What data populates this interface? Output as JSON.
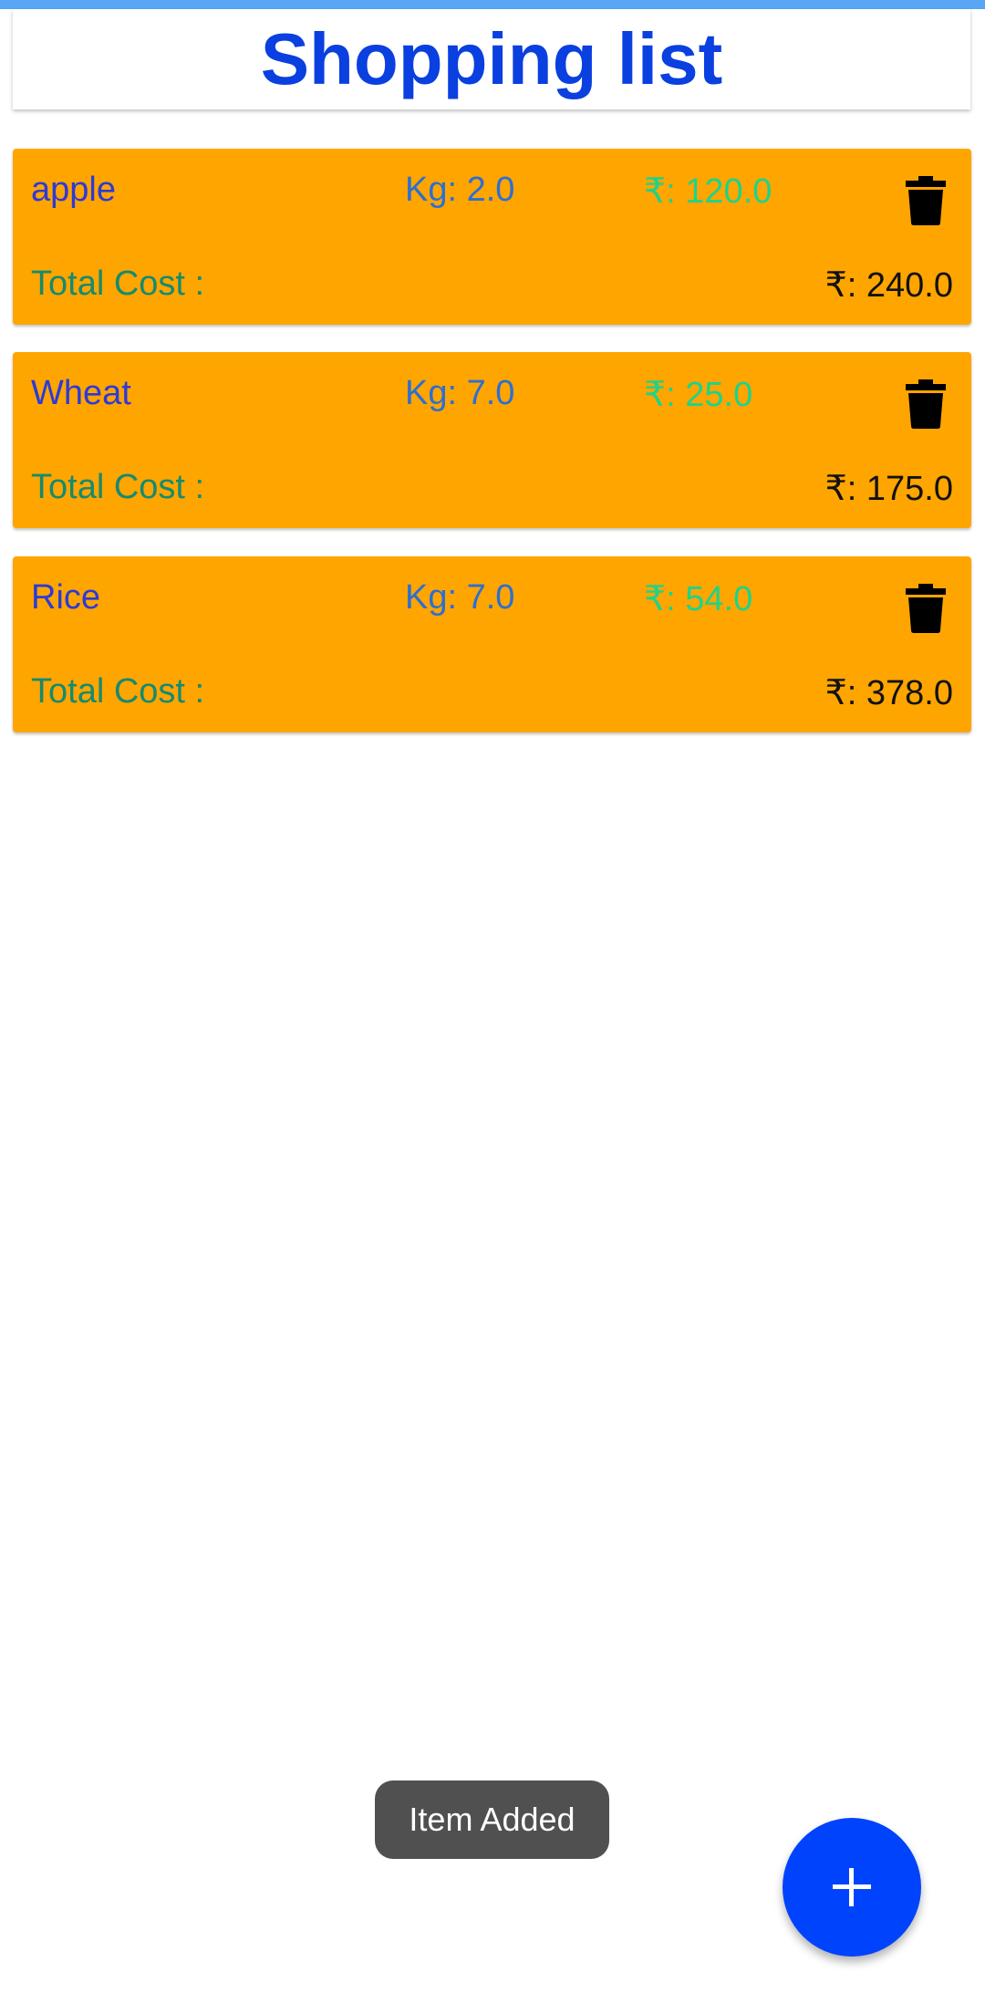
{
  "app": {
    "title": "Shopping list",
    "accent_color": "#0a3fe0",
    "card_color": "#ffa500"
  },
  "items": [
    {
      "name": "apple",
      "qty": "Kg: 2.0",
      "price": "₹: 120.0",
      "total_label": "Total Cost :",
      "total_value": "₹: 240.0",
      "delete_icon": "trash-icon"
    },
    {
      "name": "Wheat",
      "qty": "Kg: 7.0",
      "price": "₹: 25.0",
      "total_label": "Total Cost :",
      "total_value": "₹: 175.0",
      "delete_icon": "trash-icon"
    },
    {
      "name": "Rice",
      "qty": "Kg: 7.0",
      "price": "₹: 54.0",
      "total_label": "Total Cost :",
      "total_value": "₹: 378.0",
      "delete_icon": "trash-icon"
    }
  ],
  "toast": {
    "text": "Item Added"
  },
  "fab": {
    "icon": "plus-icon",
    "color": "#0043fd"
  }
}
